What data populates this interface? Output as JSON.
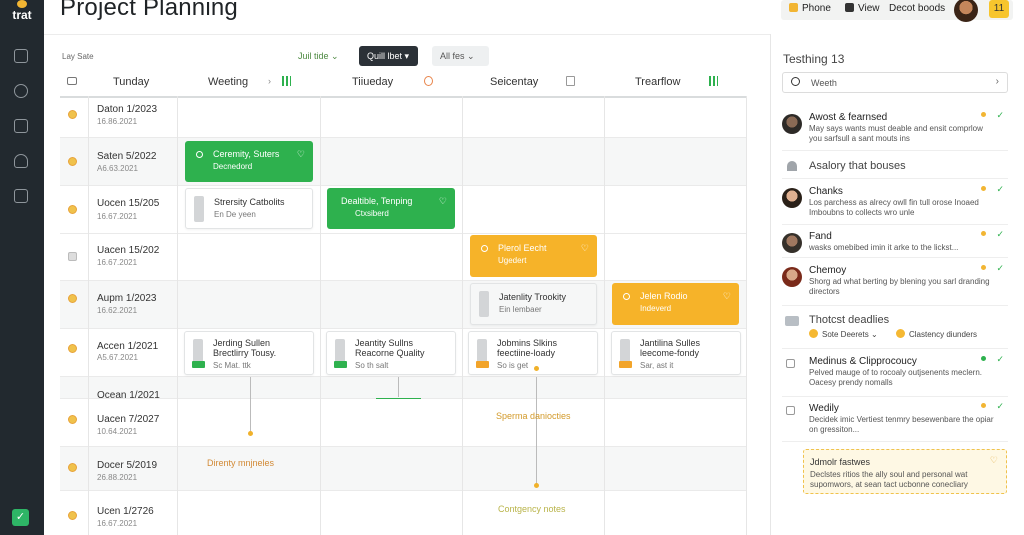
{
  "app": {
    "logo_text": "trat",
    "title": "Project Planning"
  },
  "topbar": {
    "phone": "Phone",
    "view": "View",
    "decor": "Decot boods",
    "badge": "11"
  },
  "toolbar": {
    "label": "Lay Sate",
    "filter1": "Juil tide",
    "filter2": "Quill lbet",
    "filter3": "All fes"
  },
  "columns": [
    "Tunday",
    "Weeting",
    "Tiiueday",
    "Seicentay",
    "Trearflow"
  ],
  "rows": [
    {
      "title": "Daton 1/2023",
      "sub": "16.86.2021"
    },
    {
      "title": "Saten 5/2022",
      "sub": "A6.63.2021"
    },
    {
      "title": "Uocen 15/205",
      "sub": "16.67.2021"
    },
    {
      "title": "Uacen 15/202",
      "sub": "16.67.2021"
    },
    {
      "title": "Aupm 1/2023",
      "sub": "16.62.2021"
    },
    {
      "title": "Accen 1/2021",
      "sub": "A5.67.2021"
    },
    {
      "title": "Ocean 1/2021",
      "sub": ""
    },
    {
      "title": "Uacen 7/2027",
      "sub": "10.64.2021"
    },
    {
      "title": "Docer 5/2019",
      "sub": "26.88.2021"
    },
    {
      "title": "Ucen 1/2726",
      "sub": "16.67.2021"
    }
  ],
  "cards": {
    "c1": {
      "title": "Ceremity, Suters",
      "sub": "Decnedord"
    },
    "c2": {
      "title": "Strersity Catbolits",
      "sub": "En De yeen"
    },
    "c3": {
      "title": "Dealtible, Tenping",
      "sub": "Ctxsiberd"
    },
    "c4": {
      "title": "Plerol Eecht",
      "sub": "Ugedert"
    },
    "c5": {
      "title": "Jatenlity Trookity",
      "sub": "Ein lembaer"
    },
    "c6": {
      "title": "Jelen Rodio",
      "sub": "Indeverd"
    },
    "c7": {
      "title": "Jerding Sullen",
      "title2": "Brectlirry Tousy.",
      "sub": "Sc Mat. ttk"
    },
    "c8": {
      "title": "Jeantity Sullns",
      "title2": "Reacorne Quality",
      "sub": "So th salt"
    },
    "c9": {
      "title": "Jobmins Slkins",
      "title2": "feectiine-loady",
      "sub": "So is get"
    },
    "c10": {
      "title": "Jantilina Sulles",
      "title2": "leecome-fondy",
      "sub": "Sar, ast it"
    }
  },
  "notes": {
    "n1": "Sperma daniocties",
    "n2": "Direnty mnjneles",
    "n3": "Contgency notes"
  },
  "panel": {
    "title": "Testhing 13",
    "search": "Weeth",
    "m1": {
      "name": "Awost & fearnsed",
      "body": "May says wants must deable and ensit comprlow you sarfsull a sant mouts ins"
    },
    "sect1": "Asalory that bouses",
    "m2": {
      "name": "Chanks",
      "body": "Los parchess as alrecy owll fin tull orose Inoaed Imboubns to collects wro unle"
    },
    "m3": {
      "name": "Fand",
      "body": "wasks omebibed imin it arke to the lickst..."
    },
    "m4": {
      "name": "Chemoy",
      "body": "Shorg ad what berting by blening you sarl dranding directors"
    },
    "sect2": "Thotcst deadlies",
    "chip1": "Sote Deerets",
    "chip2": "Clastency diunders",
    "m5": {
      "name": "Medinus & Clipprocoucy",
      "body": "Pelved mauge of to rocoaly outjsenents meclern. Oacesy prendy nomalls"
    },
    "m6": {
      "name": "Wedily",
      "body": "Decidek imic Vertiest tenmry besewenbare the opiar on gressiton..."
    },
    "box": {
      "title": "Jdmolr fastwes",
      "body": "Declstes ritios the ally soul and personal wat supomwors, at sean tact ucbonne conecliary"
    }
  },
  "colors": {
    "accent_green": "#2eb14e",
    "accent_orange": "#f6b329",
    "rail": "#22292f"
  }
}
